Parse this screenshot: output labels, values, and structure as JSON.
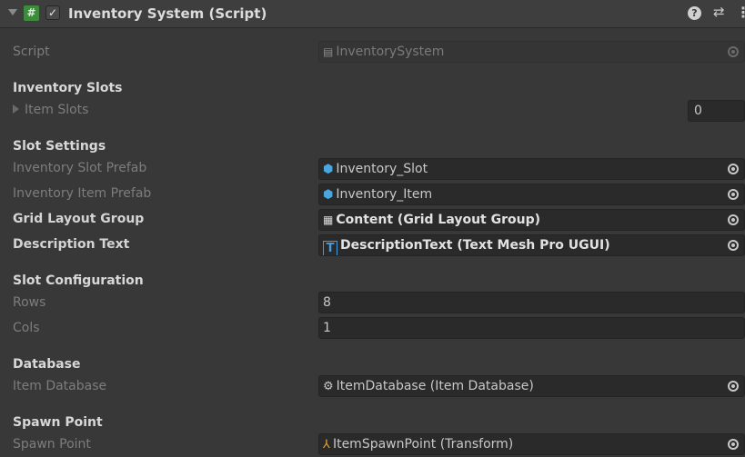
{
  "header": {
    "title": "Inventory System (Script)",
    "enabled": true,
    "script_icon": "#",
    "help_icon": "?",
    "preset_icon": "⇄",
    "menu_icon": "⋮"
  },
  "script": {
    "label": "Script",
    "value": "InventorySystem"
  },
  "inventory_slots": {
    "heading": "Inventory Slots",
    "item_slots_label": "Item Slots",
    "item_slots_count": "0"
  },
  "slot_settings": {
    "heading": "Slot Settings",
    "slot_prefab_label": "Inventory Slot Prefab",
    "slot_prefab_value": "Inventory_Slot",
    "item_prefab_label": "Inventory Item Prefab",
    "item_prefab_value": "Inventory_Item",
    "grid_label": "Grid Layout Group",
    "grid_value": "Content (Grid Layout Group)",
    "desc_label": "Description Text",
    "desc_value": "DescriptionText (Text Mesh Pro UGUI)",
    "tmp_icon": "T"
  },
  "slot_configuration": {
    "heading": "Slot Configuration",
    "rows_label": "Rows",
    "rows_value": "8",
    "cols_label": "Cols",
    "cols_value": "1"
  },
  "database": {
    "heading": "Database",
    "item_db_label": "Item Database",
    "item_db_value": "ItemDatabase (Item Database)"
  },
  "spawn_point": {
    "heading": "Spawn Point",
    "label": "Spawn Point",
    "value": "ItemSpawnPoint (Transform)"
  }
}
